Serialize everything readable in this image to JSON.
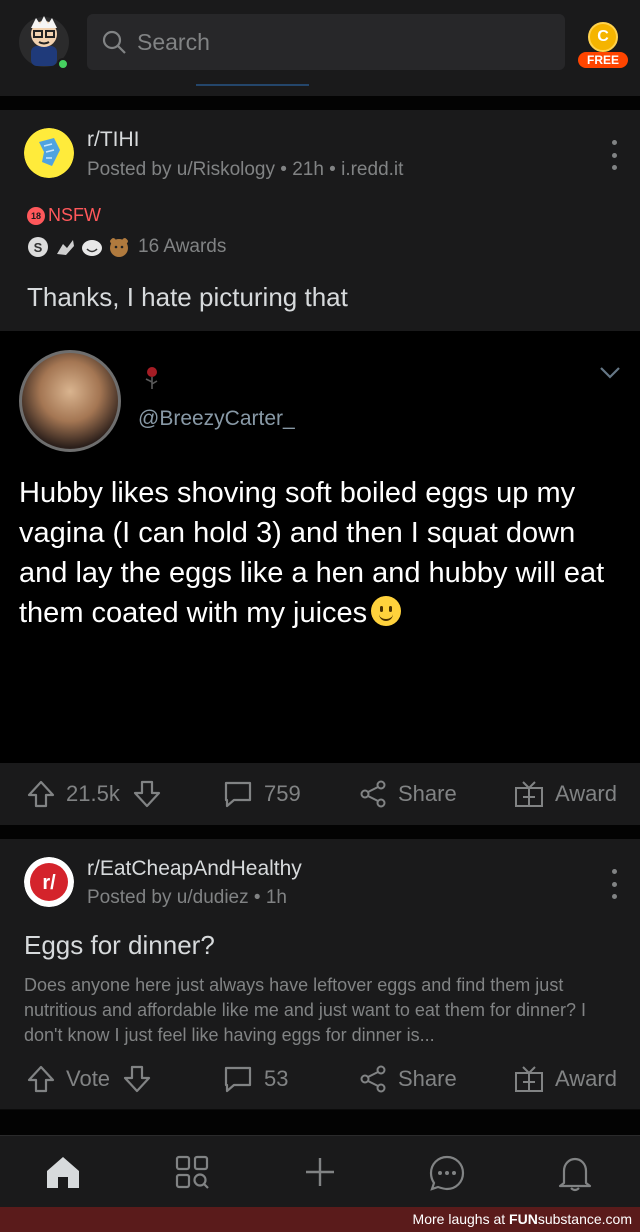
{
  "topbar": {
    "search_placeholder": "Search",
    "coin_symbol": "C",
    "free_label": "FREE"
  },
  "post1": {
    "subreddit": "r/TIHI",
    "meta": "Posted by u/Riskology • 21h • i.redd.it",
    "nsfw_badge": "18",
    "nsfw_label": "NSFW",
    "awards_label": "16 Awards",
    "title": "Thanks, I hate picturing that",
    "tweet": {
      "handle": "@BreezyCarter_",
      "text": "Hubby likes shoving soft boiled eggs up my vagina (I can hold 3) and then I squat down and lay the eggs like a hen and hubby will eat them coated with my juices"
    },
    "votes": "21.5k",
    "comments": "759",
    "share_label": "Share",
    "award_label": "Award"
  },
  "post2": {
    "subreddit": "r/EatCheapAndHealthy",
    "meta": "Posted by u/dudiez • 1h",
    "icon_text": "r/",
    "title": "Eggs for dinner?",
    "body": "Does anyone here just always have leftover eggs and find them just nutritious and affordable like me and just want to eat them for dinner? I don't know I just feel like having eggs for dinner is...",
    "votes": "Vote",
    "comments": "53",
    "share_label": "Share",
    "award_label": "Award"
  },
  "footer": {
    "prefix": "More laughs at",
    "brand_bold": "FUN",
    "brand_rest": "substance.com"
  },
  "colors": {
    "background": "#0b0b0b",
    "card": "#1a1a1b",
    "text": "#d7dadc",
    "muted": "#818384",
    "nsfw": "#ff585b",
    "accent": "#ff4500"
  }
}
